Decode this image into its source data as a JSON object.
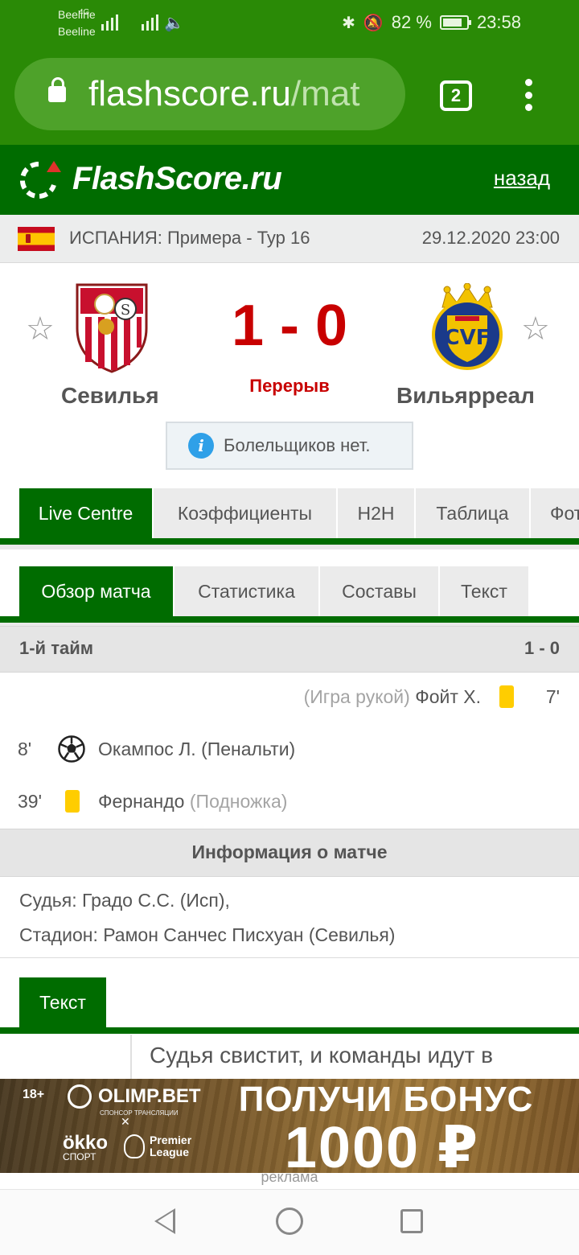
{
  "status_bar": {
    "carrier1": "Beeline",
    "carrier2": "Beeline",
    "network": "4G",
    "battery": "82 %",
    "time": "23:58"
  },
  "browser": {
    "url_domain": "flashscore.ru",
    "url_rest": "/mat",
    "tab_count": "2"
  },
  "site": {
    "logo": "FlashScore.ru",
    "back": "назад"
  },
  "league": {
    "name": "ИСПАНИЯ: Примера - Тур 16",
    "date": "29.12.2020 23:00"
  },
  "match": {
    "home": "Севилья",
    "away": "Вильярреал",
    "score": "1 - 0",
    "status": "Перерыв",
    "fans_info": "Болельщиков нет."
  },
  "main_tabs": [
    "Live Centre",
    "Коэффициенты",
    "H2H",
    "Таблица",
    "Фото"
  ],
  "sub_tabs": [
    "Обзор матча",
    "Статистика",
    "Составы",
    "Текст"
  ],
  "first_half": {
    "label": "1-й тайм",
    "score": "1 - 0",
    "events": [
      {
        "minute": "7'",
        "player": "Фойт Х.",
        "detail": "(Игра рукой)",
        "type": "yellow-card",
        "side": "away"
      },
      {
        "minute": "8'",
        "player": "Окампос Л. (Пенальти)",
        "detail": "",
        "type": "goal",
        "side": "home"
      },
      {
        "minute": "39'",
        "player": "Фернандо",
        "detail": "(Подножка)",
        "type": "yellow-card",
        "side": "home"
      }
    ]
  },
  "match_info": {
    "title": "Информация о матче",
    "referee": "Судья: Градо С.С. (Исп),",
    "stadium": "Стадион: Рамон Санчес Писхуан (Севилья)"
  },
  "commentary": {
    "tab": "Текст",
    "first_line": "Судья свистит, и команды идут в"
  },
  "ad": {
    "age": "18+",
    "brand": "OLIMP.BET",
    "sponsor": "СПОНСОР ТРАНСЛЯЦИИ",
    "x": "✕",
    "okko": "ökko",
    "okko_sub": "СПОРТ",
    "pl_line1": "Premier",
    "pl_line2": "League",
    "headline": "ПОЛУЧИ БОНУС",
    "amount": "1000 ₽",
    "label": "реклама"
  },
  "colors": {
    "brand_green": "#006c00",
    "browser_green": "#2a8a06",
    "score_red": "#c80000",
    "yellow_card": "#ffcd00"
  }
}
